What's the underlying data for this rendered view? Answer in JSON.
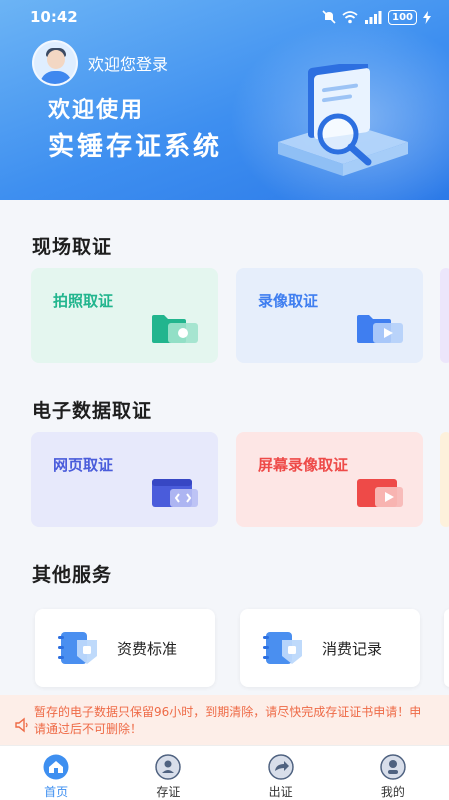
{
  "status_bar": {
    "time": "10:42",
    "battery": "100"
  },
  "header": {
    "login_text": "欢迎您登录",
    "title_line1": "欢迎使用",
    "title_line2": "实锤存证系统"
  },
  "sections": {
    "onsite": {
      "title": "现场取证",
      "cards": [
        {
          "label": "拍照取证",
          "icon": "camera-folder-icon",
          "color": "#22b58e",
          "bg": "#e4f6ef"
        },
        {
          "label": "录像取证",
          "icon": "video-folder-icon",
          "color": "#3f7ef0",
          "bg": "#e6eefb"
        }
      ]
    },
    "electronic": {
      "title": "电子数据取证",
      "cards": [
        {
          "label": "网页取证",
          "icon": "webpage-folder-icon",
          "color": "#4a5cdb",
          "bg": "#e7e9fb"
        },
        {
          "label": "屏幕录像取证",
          "icon": "screen-record-folder-icon",
          "color": "#ee4a48",
          "bg": "#fde6e5"
        }
      ]
    },
    "other": {
      "title": "其他服务",
      "items": [
        {
          "label": "资费标准",
          "icon": "pricing-icon"
        },
        {
          "label": "消费记录",
          "icon": "consumption-record-icon"
        }
      ]
    }
  },
  "notice": {
    "text": "暂存的电子数据只保留96小时，到期清除，请尽快完成存证证书申请！申请通过后不可删除！"
  },
  "tabbar": {
    "items": [
      {
        "label": "首页",
        "icon": "home-icon",
        "active": true
      },
      {
        "label": "存证",
        "icon": "deposit-icon",
        "active": false
      },
      {
        "label": "出证",
        "icon": "issue-certificate-icon",
        "active": false
      },
      {
        "label": "我的",
        "icon": "profile-icon",
        "active": false
      }
    ]
  },
  "colors": {
    "primary": "#3e8ff0",
    "notice_text": "#ee6a46",
    "notice_bg": "#fdeee8"
  }
}
